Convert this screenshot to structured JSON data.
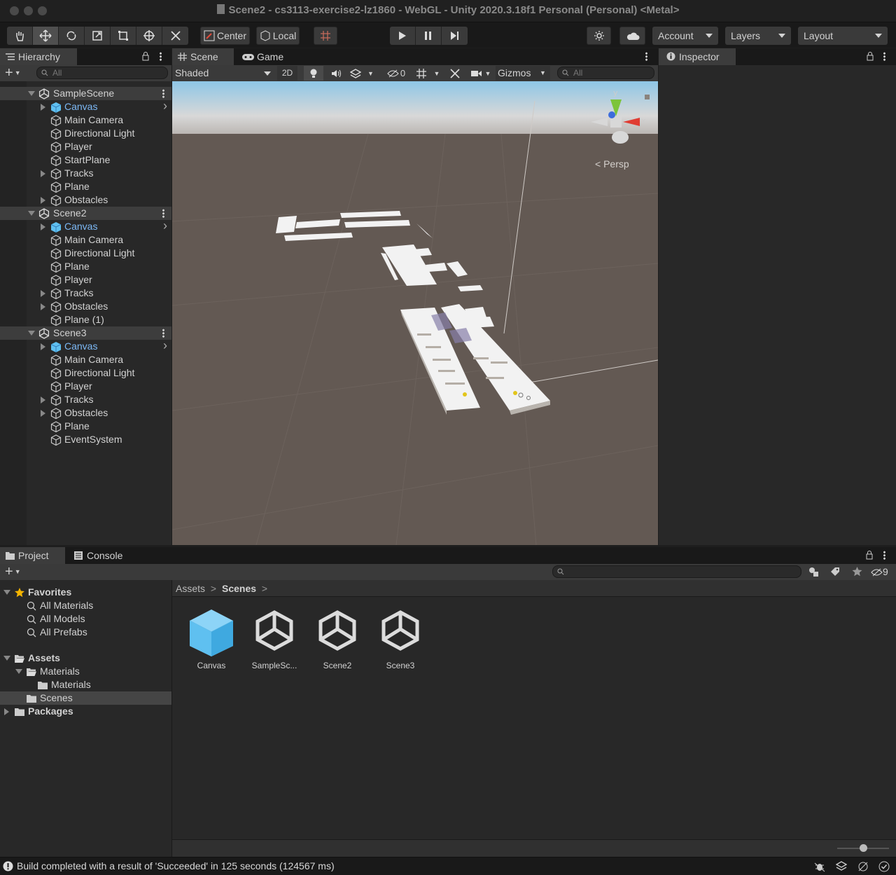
{
  "window": {
    "title": "Scene2 - cs3113-exercise2-lz1860 - WebGL - Unity 2020.3.18f1 Personal (Personal) <Metal>"
  },
  "toolbar": {
    "center_label": "Center",
    "local_label": "Local",
    "account_label": "Account",
    "layers_label": "Layers",
    "layout_label": "Layout"
  },
  "hierarchy": {
    "tab_label": "Hierarchy",
    "search_placeholder": "All",
    "rows": [
      {
        "label": "SampleScene",
        "type": "scene"
      },
      {
        "label": "Canvas",
        "type": "canvas"
      },
      {
        "label": "Main Camera"
      },
      {
        "label": "Directional Light"
      },
      {
        "label": "Player"
      },
      {
        "label": "StartPlane"
      },
      {
        "label": "Tracks",
        "expand": true
      },
      {
        "label": "Plane"
      },
      {
        "label": "Obstacles",
        "expand": true
      },
      {
        "label": "Scene2",
        "type": "scene"
      },
      {
        "label": "Canvas",
        "type": "canvas"
      },
      {
        "label": "Main Camera"
      },
      {
        "label": "Directional Light"
      },
      {
        "label": "Plane"
      },
      {
        "label": "Player"
      },
      {
        "label": "Tracks",
        "expand": true
      },
      {
        "label": "Obstacles",
        "expand": true
      },
      {
        "label": "Plane (1)"
      },
      {
        "label": "Scene3",
        "type": "scene"
      },
      {
        "label": "Canvas",
        "type": "canvas"
      },
      {
        "label": "Main Camera"
      },
      {
        "label": "Directional Light"
      },
      {
        "label": "Player"
      },
      {
        "label": "Tracks",
        "expand": true
      },
      {
        "label": "Obstacles",
        "expand": true
      },
      {
        "label": "Plane"
      },
      {
        "label": "EventSystem"
      }
    ]
  },
  "scene_panel": {
    "tab_scene": "Scene",
    "tab_game": "Game",
    "shading_mode": "Shaded",
    "mode_2d": "2D",
    "hidden_count": "0",
    "gizmos_label": "Gizmos",
    "search_placeholder": "All",
    "persp_label": "Persp",
    "axis_y": "y",
    "axis_x": "x"
  },
  "inspector": {
    "tab_label": "Inspector"
  },
  "project": {
    "tab_project": "Project",
    "tab_console": "Console",
    "hidden_count": "9",
    "breadcrumb": {
      "root": "Assets",
      "current": "Scenes"
    },
    "tree": [
      {
        "label": "Favorites",
        "bold": true,
        "indent": 0,
        "icon": "star-icon"
      },
      {
        "label": "All Materials",
        "indent": 1,
        "icon": "search-icon"
      },
      {
        "label": "All Models",
        "indent": 1,
        "icon": "search-icon"
      },
      {
        "label": "All Prefabs",
        "indent": 1,
        "icon": "search-icon"
      },
      {
        "label": "Assets",
        "bold": true,
        "indent": 0,
        "icon": "folder-open-icon"
      },
      {
        "label": "Materials",
        "indent": 1,
        "icon": "folder-open-icon"
      },
      {
        "label": "Materials",
        "indent": 2,
        "icon": "folder-icon"
      },
      {
        "label": "Scenes",
        "indent": 1,
        "icon": "folder-icon",
        "selected": true
      },
      {
        "label": "Packages",
        "bold": true,
        "indent": 0,
        "icon": "folder-icon"
      }
    ],
    "assets": [
      {
        "label": "Canvas",
        "icon": "prefab-cube-icon"
      },
      {
        "label": "SampleSc...",
        "icon": "unity-scene-icon"
      },
      {
        "label": "Scene2",
        "icon": "unity-scene-icon"
      },
      {
        "label": "Scene3",
        "icon": "unity-scene-icon"
      }
    ]
  },
  "status": {
    "message": "Build completed with a result of 'Succeeded' in 125 seconds (124567 ms)"
  }
}
